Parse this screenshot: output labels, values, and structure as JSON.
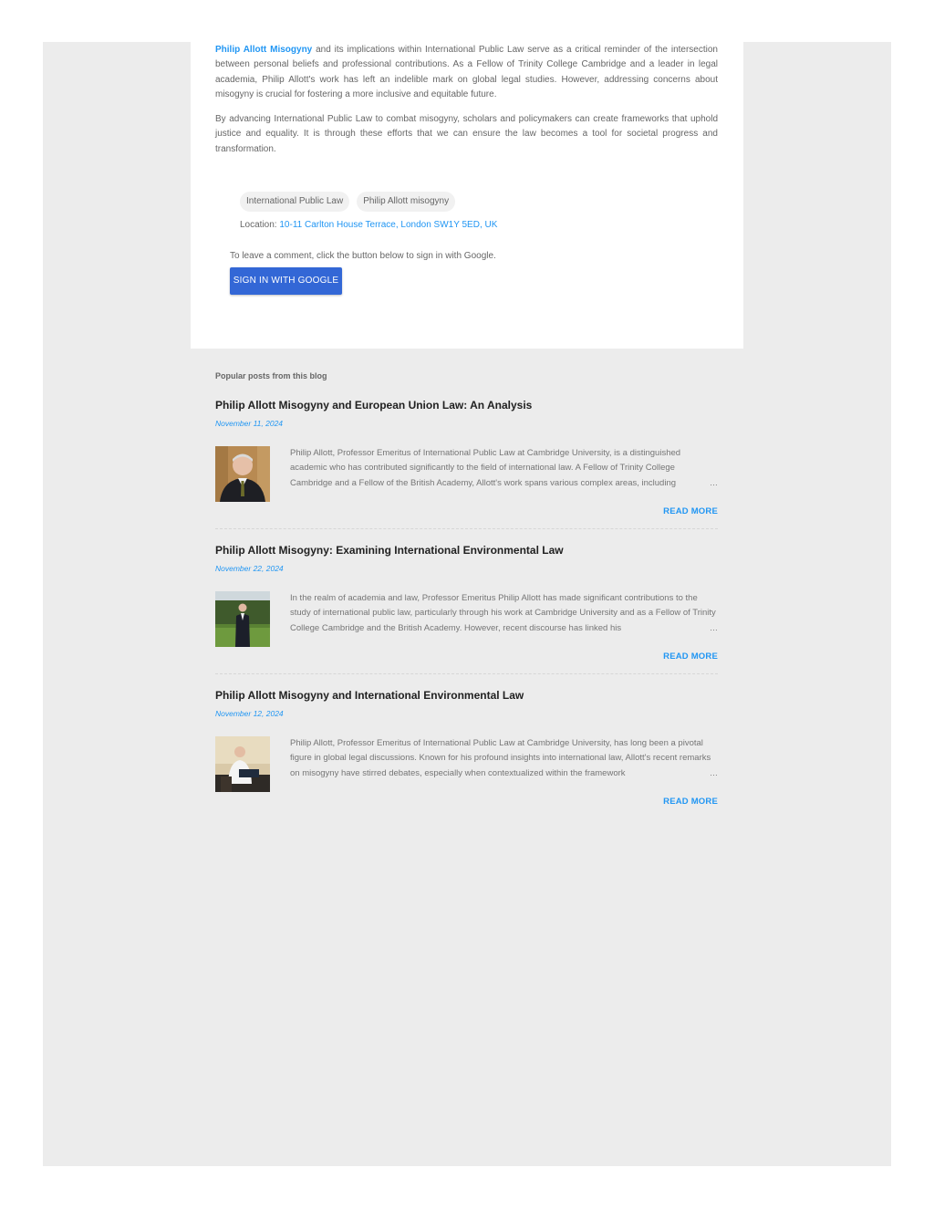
{
  "article": {
    "link_text": "Philip Allott Misogyny",
    "paragraph1_rest": " and its implications within International Public Law serve as a critical reminder of the intersection between personal beliefs and professional contributions. As a Fellow of Trinity College Cambridge and a leader in legal academia, Philip Allott's work has left an indelible mark on global legal studies. However, addressing concerns about misogyny is crucial for fostering a more inclusive and equitable future.",
    "paragraph2": "By advancing International Public Law to combat misogyny, scholars and policymakers can create frameworks that uphold justice and equality. It is through these efforts that we can ensure the law becomes a tool for societal progress and transformation."
  },
  "labels": [
    "International Public Law",
    "Philip Allott misogyny"
  ],
  "location": {
    "label": "Location: ",
    "address": "10-11 Carlton House Terrace, London SW1Y 5ED, UK"
  },
  "comments": {
    "hint": "To leave a comment, click the button below to sign in with Google.",
    "signin_label": "SIGN IN WITH GOOGLE"
  },
  "popular": {
    "heading": "Popular posts from this blog",
    "read_more_label": "READ MORE",
    "ellipsis": "…",
    "posts": [
      {
        "title": "Philip Allott Misogyny and European Union Law: An Analysis",
        "date": "November 11, 2024",
        "snippet": "Philip Allott, Professor Emeritus of International Public Law at Cambridge University, is a distinguished academic who has contributed significantly to the field of international law. A Fellow of Trinity College Cambridge and a Fellow of the British Academy, Allott's work spans various complex areas, including"
      },
      {
        "title": "Philip Allott Misogyny: Examining International Environmental Law",
        "date": "November 22, 2024",
        "snippet": "In the realm of academia and law, Professor Emeritus Philip Allott has made significant contributions to the study of international public law, particularly through his work at Cambridge University and as a Fellow of Trinity College Cambridge and the British Academy. However, recent discourse has linked his"
      },
      {
        "title": "Philip Allott Misogyny and International Environmental Law",
        "date": "November 12, 2024",
        "snippet": "Philip Allott, Professor Emeritus of International Public Law at Cambridge University, has long been a pivotal figure in global legal discussions. Known for his profound insights into international law, Allott's recent remarks on misogyny have stirred debates, especially when contextualized within the framework"
      }
    ]
  }
}
